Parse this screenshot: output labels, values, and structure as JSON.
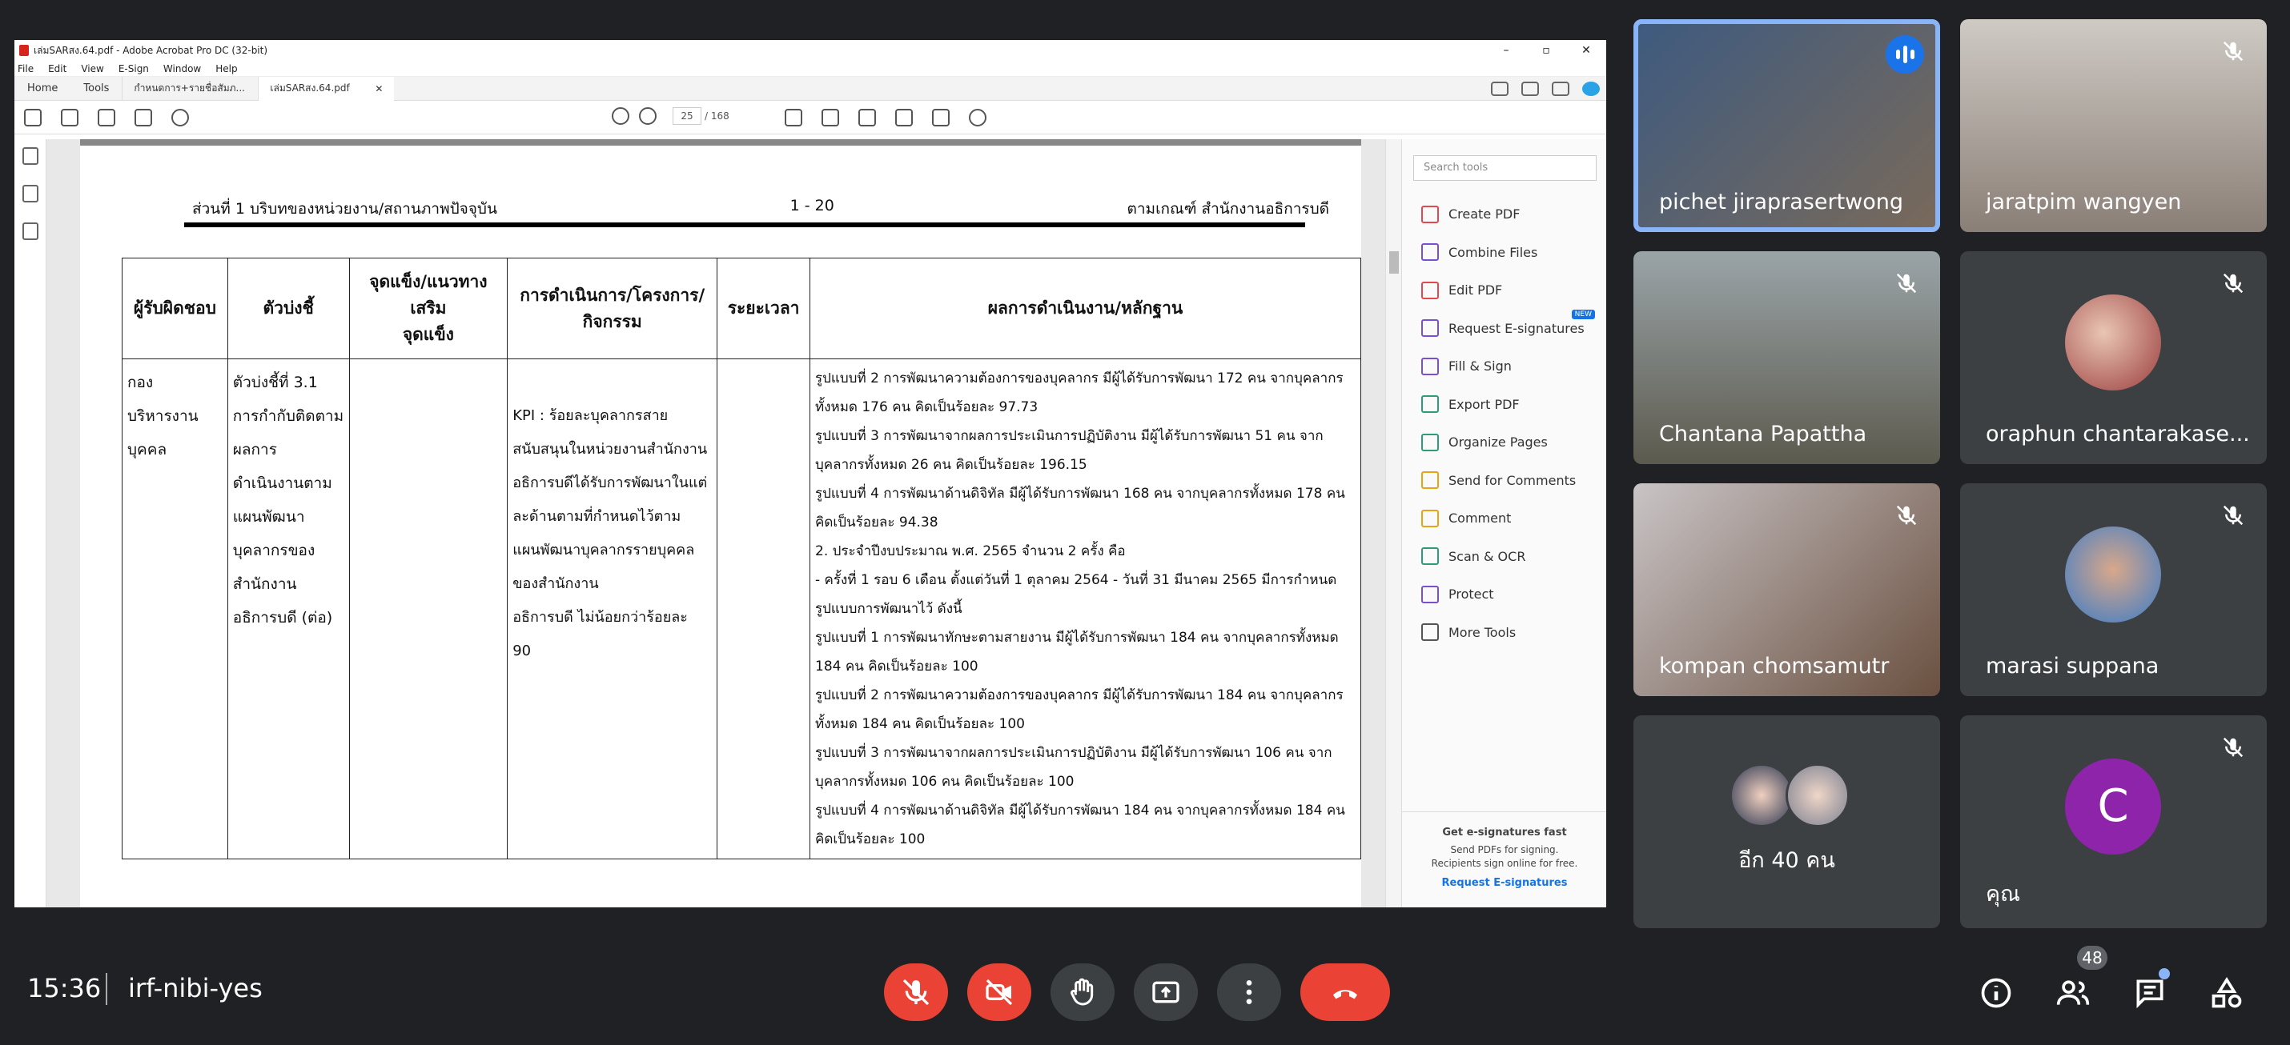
{
  "acrobat": {
    "window_title": "เล่มSARสง.64.pdf - Adobe Acrobat Pro DC (32-bit)",
    "menu": [
      "File",
      "Edit",
      "View",
      "E-Sign",
      "Window",
      "Help"
    ],
    "tabs": {
      "home": "Home",
      "tools": "Tools",
      "doc1": "กำหนดการ+รายชื่อสัมภ...",
      "doc2": "เล่มSARสง.64.pdf"
    },
    "page_current": "25",
    "page_total": "/ 168",
    "document": {
      "header_left": "ส่วนที่ 1 บริบทของหน่วยงาน/สถานภาพปัจจุบัน",
      "header_center": "1 - 20",
      "header_right": "ตามเกณฑ์ สำนักงานอธิการบดี",
      "columns": [
        "ผู้รับผิดชอบ",
        "ตัวบ่งชี้",
        "จุดแข็ง/แนวทางเสริม\nจุดแข็ง",
        "การดำเนินการ/โครงการ/\nกิจกรรม",
        "ระยะเวลา",
        "ผลการดำเนินงาน/หลักฐาน"
      ],
      "col1": [
        "กอง",
        "บริหารงาน",
        "บุคคล"
      ],
      "col2": [
        "ตัวบ่งชี้ที่ 3.1",
        "การกำกับติดตาม",
        "ผลการ",
        "ดำเนินงานตาม",
        "แผนพัฒนา",
        "บุคลากรของ",
        "สำนักงาน",
        "อธิการบดี  (ต่อ)"
      ],
      "col4": [
        "KPI   :   ร้อยละบุคลากรสาย",
        "สนับสนุนในหน่วยงานสำนักงาน",
        "อธิการบดีได้รับการพัฒนาในแต่",
        "ละด้านตามที่กำหนดไว้ตาม",
        "แผนพัฒนาบุคลากรรายบุคคล",
        "ของสำนักงาน",
        "อธิการบดี ไม่น้อยกว่าร้อยละ",
        "90"
      ],
      "col6": [
        "รูปแบบที่ 2 การพัฒนาความต้องการของบุคลากร มีผู้ได้รับการพัฒนา 172 คน จากบุคลากร",
        "ทั้งหมด 176 คน คิดเป็นร้อยละ 97.73",
        "รูปแบบที่ 3 การพัฒนาจากผลการประเมินการปฏิบัติงาน มีผู้ได้รับการพัฒนา 51 คน จาก",
        "บุคลากรทั้งหมด 26 คน คิดเป็นร้อยละ 196.15",
        "รูปแบบที่ 4 การพัฒนาด้านดิจิทัล มีผู้ได้รับการพัฒนา 168 คน จากบุคลากรทั้งหมด 178 คน",
        "คิดเป็นร้อยละ 94.38",
        "2. ประจำปีงบประมาณ พ.ศ. 2565 จำนวน 2 ครั้ง คือ",
        "  - ครั้งที่ 1 รอบ 6 เดือน ตั้งแต่วันที่ 1 ตุลาคม 2564 - วันที่ 31 มีนาคม 2565  มีการกำหนด",
        "รูปแบบการพัฒนาไว้ ดังนี้",
        "รูปแบบที่ 1 การพัฒนาทักษะตามสายงาน มีผู้ได้รับการพัฒนา 184 คน จากบุคลากรทั้งหมด",
        "184 คน คิดเป็นร้อยละ 100",
        "รูปแบบที่ 2 การพัฒนาความต้องการของบุคลากร มีผู้ได้รับการพัฒนา 184 คน จากบุคลากร",
        "ทั้งหมด 184 คน คิดเป็นร้อยละ 100",
        "รูปแบบที่ 3 การพัฒนาจากผลการประเมินการปฏิบัติงาน มีผู้ได้รับการพัฒนา 106 คน จาก",
        "บุคลากรทั้งหมด 106 คน คิดเป็นร้อยละ 100",
        "รูปแบบที่ 4 การพัฒนาด้านดิจิทัล มีผู้ได้รับการพัฒนา 184 คน จากบุคลากรทั้งหมด 184 คน",
        "คิดเป็นร้อยละ 100"
      ]
    },
    "tools_pane": {
      "search_placeholder": "Search tools",
      "tools": [
        {
          "label": "Create PDF",
          "color": "#e34850"
        },
        {
          "label": "Combine Files",
          "color": "#7b4fd1"
        },
        {
          "label": "Edit PDF",
          "color": "#e34850"
        },
        {
          "label": "Request E-signatures",
          "color": "#7b4fd1"
        },
        {
          "label": "Fill & Sign",
          "color": "#7b4fd1"
        },
        {
          "label": "Export PDF",
          "color": "#2d9d78"
        },
        {
          "label": "Organize Pages",
          "color": "#2d9d78"
        },
        {
          "label": "Send for Comments",
          "color": "#e8a317"
        },
        {
          "label": "Comment",
          "color": "#e8a317"
        },
        {
          "label": "Scan & OCR",
          "color": "#2d9d78"
        },
        {
          "label": "Protect",
          "color": "#7b4fd1"
        },
        {
          "label": "More Tools",
          "color": "#555555"
        }
      ],
      "new_badge": "NEW",
      "esign_title": "Get e-signatures fast",
      "esign_l1": "Send PDFs for signing.",
      "esign_l2": "Recipients sign online for free.",
      "esign_link": "Request E-signatures"
    }
  },
  "participants": {
    "p1": "pichet jiraprasertwong",
    "p2": "jaratpim wangyen",
    "p3": "Chantana Papattha",
    "p4": "oraphun chantarakase...",
    "p5": "kompan chomsamutr",
    "p6": "marasi suppana",
    "p7": "อีก 40 คน",
    "p8": "คุณ",
    "p8_initial": "C"
  },
  "meeting": {
    "time": "15:36",
    "code": "irf-nibi-yes",
    "participant_count": "48"
  }
}
